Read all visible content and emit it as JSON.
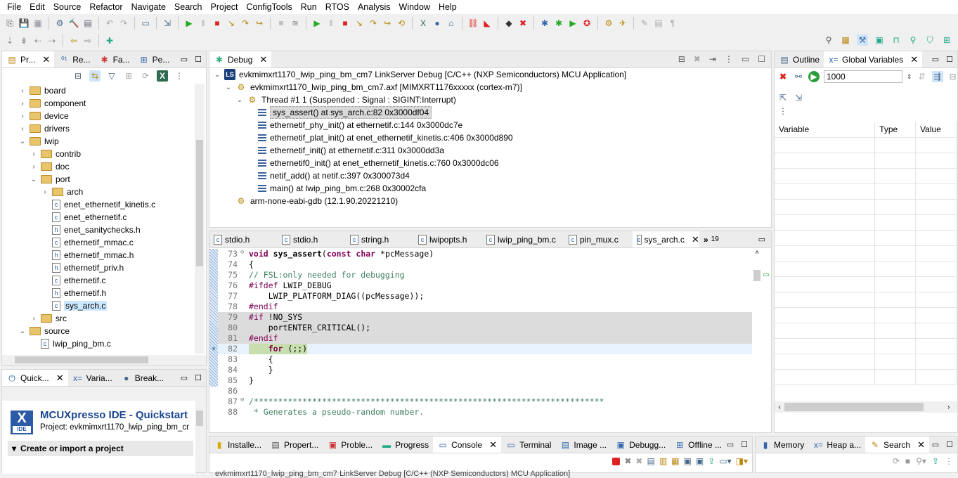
{
  "menu": [
    "File",
    "Edit",
    "Source",
    "Refactor",
    "Navigate",
    "Search",
    "Project",
    "ConfigTools",
    "Run",
    "RTOS",
    "Analysis",
    "Window",
    "Help"
  ],
  "left_top": {
    "tabs": [
      "Pr...",
      "Re...",
      "Fa...",
      "Pe..."
    ],
    "tree": [
      {
        "label": "board",
        "depth": 0,
        "type": "folder",
        "state": "closed"
      },
      {
        "label": "component",
        "depth": 0,
        "type": "folder",
        "state": "closed"
      },
      {
        "label": "device",
        "depth": 0,
        "type": "folder",
        "state": "closed"
      },
      {
        "label": "drivers",
        "depth": 0,
        "type": "folder",
        "state": "closed"
      },
      {
        "label": "lwip",
        "depth": 0,
        "type": "folder",
        "state": "open"
      },
      {
        "label": "contrib",
        "depth": 1,
        "type": "folder",
        "state": "closed"
      },
      {
        "label": "doc",
        "depth": 1,
        "type": "folder",
        "state": "closed"
      },
      {
        "label": "port",
        "depth": 1,
        "type": "folder",
        "state": "open"
      },
      {
        "label": "arch",
        "depth": 2,
        "type": "folder",
        "state": "closed"
      },
      {
        "label": "enet_ethernetif_kinetis.c",
        "depth": 2,
        "type": "c",
        "state": "closed"
      },
      {
        "label": "enet_ethernetif.c",
        "depth": 2,
        "type": "c",
        "state": "closed"
      },
      {
        "label": "enet_sanitychecks.h",
        "depth": 2,
        "type": "h",
        "state": "closed"
      },
      {
        "label": "ethernetif_mmac.c",
        "depth": 2,
        "type": "c",
        "state": "closed"
      },
      {
        "label": "ethernetif_mmac.h",
        "depth": 2,
        "type": "h",
        "state": "closed"
      },
      {
        "label": "ethernetif_priv.h",
        "depth": 2,
        "type": "h",
        "state": "closed"
      },
      {
        "label": "ethernetif.c",
        "depth": 2,
        "type": "c",
        "state": "closed"
      },
      {
        "label": "ethernetif.h",
        "depth": 2,
        "type": "h",
        "state": "closed"
      },
      {
        "label": "sys_arch.c",
        "depth": 2,
        "type": "c",
        "state": "selected"
      },
      {
        "label": "src",
        "depth": 1,
        "type": "folder",
        "state": "closed"
      },
      {
        "label": "source",
        "depth": 0,
        "type": "folder",
        "state": "open"
      },
      {
        "label": "lwip_ping_bm.c",
        "depth": 1,
        "type": "c",
        "state": "closed"
      }
    ]
  },
  "left_bottom": {
    "tabs": [
      "Quick...",
      "Varia...",
      "Break..."
    ],
    "title": "MCUXpresso IDE - Quickstart",
    "project": "Project: evkmimxrt1170_lwip_ping_bm_cr",
    "section": "Create or import a project",
    "logo_text": "IDE"
  },
  "debug": {
    "tab": "Debug",
    "items": [
      {
        "label": "evkmimxrt1170_lwip_ping_bm_cm7 LinkServer Debug [C/C++ (NXP Semiconductors) MCU Application]",
        "level": 0,
        "icon": "ls-launch-icon"
      },
      {
        "label": "evkmimxrt1170_lwip_ping_bm_cm7.axf [MIMXRT1176xxxxx (cortex-m7)]",
        "level": 1,
        "icon": "process-icon"
      },
      {
        "label": "Thread #1 1 (Suspended : Signal : SIGINT:Interrupt)",
        "level": 2,
        "icon": "thread-icon"
      },
      {
        "label": "sys_assert() at sys_arch.c:82 0x3000df04",
        "level": 3,
        "icon": "frame-icon",
        "selected": true
      },
      {
        "label": "ethernetif_phy_init() at ethernetif.c:144 0x3000dc7e",
        "level": 3,
        "icon": "frame-icon"
      },
      {
        "label": "ethernetif_plat_init() at enet_ethernetif_kinetis.c:406 0x3000d890",
        "level": 3,
        "icon": "frame-icon"
      },
      {
        "label": "ethernetif_init() at ethernetif.c:311 0x3000dd3a",
        "level": 3,
        "icon": "frame-icon"
      },
      {
        "label": "ethernetif0_init() at enet_ethernetif_kinetis.c:760 0x3000dc06",
        "level": 3,
        "icon": "frame-icon"
      },
      {
        "label": "netif_add() at netif.c:397 0x300073d4",
        "level": 3,
        "icon": "frame-icon"
      },
      {
        "label": "main() at lwip_ping_bm.c:268 0x30002cfa",
        "level": 3,
        "icon": "frame-icon"
      },
      {
        "label": "arm-none-eabi-gdb (12.1.90.20221210)",
        "level": 1,
        "icon": "gdb-icon"
      }
    ]
  },
  "editor": {
    "tabs": [
      "stdio.h",
      "stdio.h",
      "string.h",
      "lwipopts.h",
      "lwip_ping_bm.c",
      "pin_mux.c",
      "sys_arch.c"
    ],
    "active_tab": "sys_arch.c",
    "overflow_count": "19",
    "lines": [
      {
        "n": "73",
        "t": "void sys_assert(const char *pcMessage)"
      },
      {
        "n": "74",
        "t": "{"
      },
      {
        "n": "75",
        "t": "// FSL:only needed for debugging"
      },
      {
        "n": "76",
        "t": "#ifdef LWIP_DEBUG"
      },
      {
        "n": "77",
        "t": "    LWIP_PLATFORM_DIAG((pcMessage));"
      },
      {
        "n": "78",
        "t": "#endif"
      },
      {
        "n": "79",
        "t": "#if !NO_SYS"
      },
      {
        "n": "80",
        "t": "    portENTER_CRITICAL();"
      },
      {
        "n": "81",
        "t": "#endif"
      },
      {
        "n": "82",
        "t": "    for (;;)"
      },
      {
        "n": "83",
        "t": "    {"
      },
      {
        "n": "84",
        "t": "    }"
      },
      {
        "n": "85",
        "t": "}"
      },
      {
        "n": "86",
        "t": ""
      },
      {
        "n": "87",
        "t": "/************************************************************************"
      },
      {
        "n": "88",
        "t": " * Generates a pseudo-random number."
      }
    ]
  },
  "right": {
    "tabs": [
      "Outline",
      "Global Variables"
    ],
    "input_value": "1000",
    "columns": [
      "Variable",
      "Type",
      "Value"
    ]
  },
  "bottom": {
    "tabs": [
      "Installe...",
      "Propert...",
      "Proble...",
      "Progress",
      "Console",
      "Terminal",
      "Image ...",
      "Debugg...",
      "Offline ..."
    ],
    "active": "Console",
    "console_text": "evkmimxrt1170_lwip_ping_bm_cm7 LinkServer Debug [C/C++ (NXP Semiconductors) MCU Application]"
  },
  "bottom_right": {
    "tabs": [
      "Memory",
      "Heap a...",
      "Search"
    ],
    "active": "Search"
  }
}
